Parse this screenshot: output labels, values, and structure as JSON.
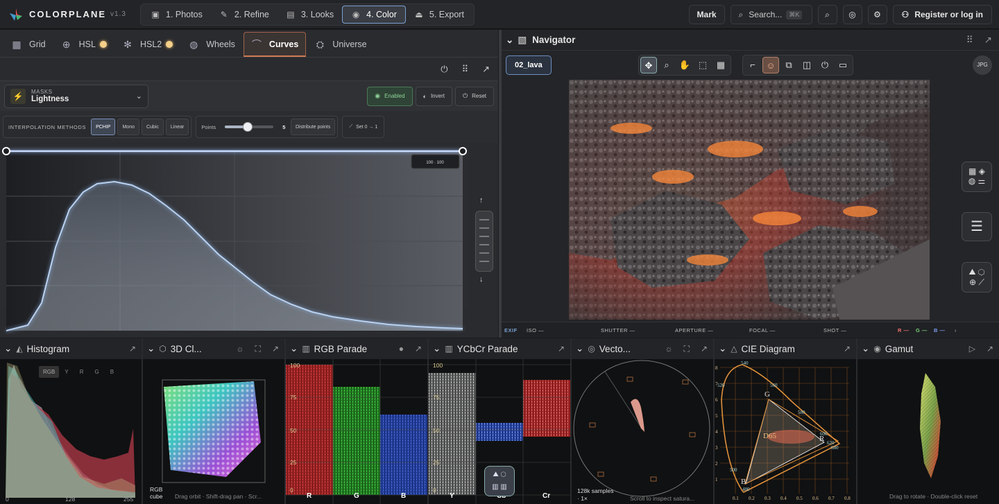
{
  "app": {
    "name": "COLORPLANE",
    "version": "v1.3"
  },
  "steps": [
    {
      "label": "1. Photos",
      "icon": "photo-icon"
    },
    {
      "label": "2. Refine",
      "icon": "wand-icon"
    },
    {
      "label": "3. Looks",
      "icon": "looks-icon"
    },
    {
      "label": "4. Color",
      "icon": "color-dot-icon"
    },
    {
      "label": "5. Export",
      "icon": "export-icon"
    }
  ],
  "topbar": {
    "mark_label": "Mark",
    "search_placeholder": "Search...",
    "search_kbd": "⌘K",
    "register_label": "Register or log in"
  },
  "color_tabs": [
    "Grid",
    "HSL",
    "HSL2",
    "Wheels",
    "Curves",
    "Universe"
  ],
  "masks": {
    "label": "MASKS",
    "value": "Lightness",
    "enabled_label": "Enabled",
    "invert_label": "Invert",
    "reset_label": "Reset"
  },
  "interp": {
    "label": "INTERPOLATION METHODS",
    "methods": [
      "PCHIP",
      "Mono",
      "Cubic",
      "Linear"
    ],
    "points_label": "Points",
    "points_value": "5",
    "distribute_label": "Distribute points",
    "set_label": "Set 0 → 1"
  },
  "curve": {
    "readout": "100 · 100"
  },
  "navigator": {
    "title": "Navigator",
    "file": "02_lava",
    "format": "JPG"
  },
  "exif": {
    "tag": "EXIF",
    "iso": "ISO —",
    "shutter": "SHUTTER —",
    "aperture": "APERTURE —",
    "focal": "FOCAL —",
    "shot": "SHOT —",
    "r": "R —",
    "g": "G —",
    "b": "B —"
  },
  "panels": {
    "histogram": {
      "title": "Histogram",
      "channels": [
        "RGB",
        "Y",
        "R",
        "G",
        "B"
      ],
      "axis": [
        "0",
        "128",
        "255"
      ]
    },
    "cloud": {
      "title": "3D Cl...",
      "footer_label": "RGB cube",
      "footer_hint": "Drag orbit · Shift-drag pan · Scr..."
    },
    "rgb_parade": {
      "title": "RGB Parade",
      "ticks": [
        "100",
        "75",
        "50",
        "25",
        "0"
      ],
      "channels": [
        "R",
        "G",
        "B"
      ]
    },
    "ycbcr_parade": {
      "title": "YCbCr Parade",
      "ticks": [
        "100",
        "75",
        "50",
        "25",
        "0"
      ],
      "channels": [
        "Y",
        "Cb",
        "Cr"
      ]
    },
    "vectorscope": {
      "title": "Vecto...",
      "samples": "128k samples",
      "zoom": "· 1×",
      "hint": "Scroll to inspect satura..."
    },
    "cie": {
      "title": "CIE Diagram",
      "white_point": "D65",
      "wavelengths": [
        "540",
        "520",
        "560",
        "580",
        "600",
        "620",
        "680",
        "500",
        "480"
      ],
      "primaries": [
        "G",
        "R",
        "B"
      ],
      "x_ticks": [
        "0.1",
        "0.2",
        "0.3",
        "0.4",
        "0.5",
        "0.6",
        "0.7",
        "0.8"
      ],
      "y_ticks": [
        "8",
        "7",
        "6",
        "5",
        "4",
        "3",
        "2",
        "1"
      ]
    },
    "gamut": {
      "title": "Gamut",
      "hint": "Drag to rotate · Double-click reset"
    }
  },
  "colors": {
    "accent": "#7aa0d0",
    "curves_tab": "#d07a54",
    "enabled": "#8fd59a",
    "cie_orange": "#e0903a"
  }
}
